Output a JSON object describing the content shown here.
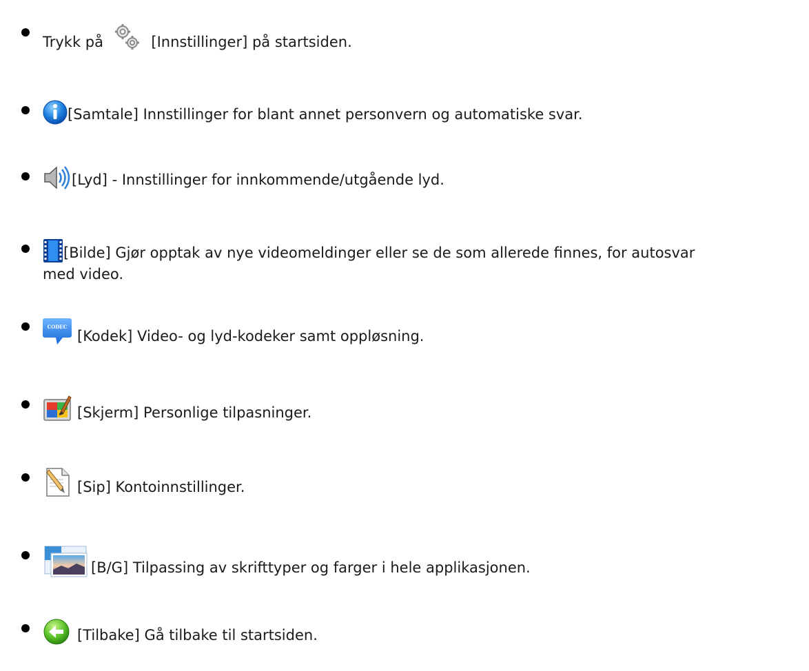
{
  "items": [
    {
      "icon": "gears-icon",
      "before": "Trykk på",
      "text": "[Innstillinger] på startsiden."
    },
    {
      "icon": "info-icon",
      "text": "[Samtale] Innstillinger for blant annet personvern og automatiske svar."
    },
    {
      "icon": "speaker-icon",
      "text": "[Lyd] - Innstillinger for innkommende/utgående lyd."
    },
    {
      "icon": "film-icon",
      "text": "[Bilde] Gjør opptak av nye videomeldinger eller se de som allerede finnes, for autosvar",
      "text2": "med video."
    },
    {
      "icon": "codec-icon",
      "icon_label": "CODEC",
      "text": "[Kodek] Video- og lyd-kodeker samt oppløsning."
    },
    {
      "icon": "display-paint-icon",
      "text": "[Skjerm] Personlige tilpasninger."
    },
    {
      "icon": "document-pencil-icon",
      "text": "[Sip] Kontoinnstillinger."
    },
    {
      "icon": "picture-icon",
      "text": "[B/G] Tilpassing av skrifttyper og farger i hele applikasjonen."
    },
    {
      "icon": "back-arrow-icon",
      "text": "[Tilbake] Gå tilbake til startsiden."
    }
  ]
}
